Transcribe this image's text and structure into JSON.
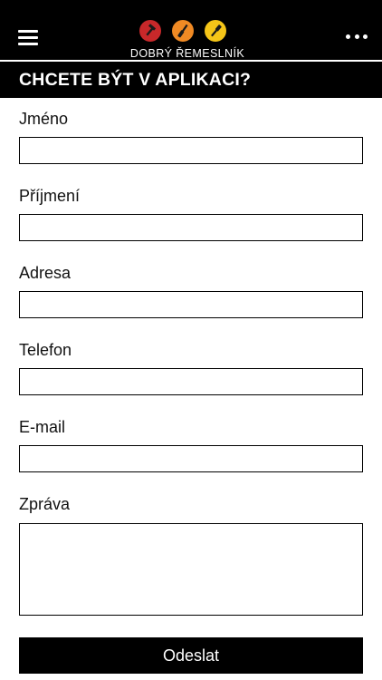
{
  "header": {
    "brand_name": "DOBRÝ ŘEMESLNÍK",
    "menu_icon": "hamburger-menu-icon",
    "more_icon": "more-horizontal-icon",
    "logo_icons": [
      {
        "name": "hammer-icon",
        "color": "#c8282a"
      },
      {
        "name": "screwdriver-icon",
        "color": "#f08a24"
      },
      {
        "name": "paint-brush-icon",
        "color": "#f5c518"
      }
    ]
  },
  "section": {
    "title": "CHCETE BÝT V APLIKACI?"
  },
  "form": {
    "fields": [
      {
        "label": "Jméno",
        "value": ""
      },
      {
        "label": "Příjmení",
        "value": ""
      },
      {
        "label": "Adresa",
        "value": ""
      },
      {
        "label": "Telefon",
        "value": ""
      },
      {
        "label": "E-mail",
        "value": ""
      }
    ],
    "message": {
      "label": "Zpráva",
      "value": ""
    },
    "submit_label": "Odeslat"
  },
  "colors": {
    "header_bg": "#000000",
    "text": "#111111",
    "button_bg": "#000000"
  }
}
